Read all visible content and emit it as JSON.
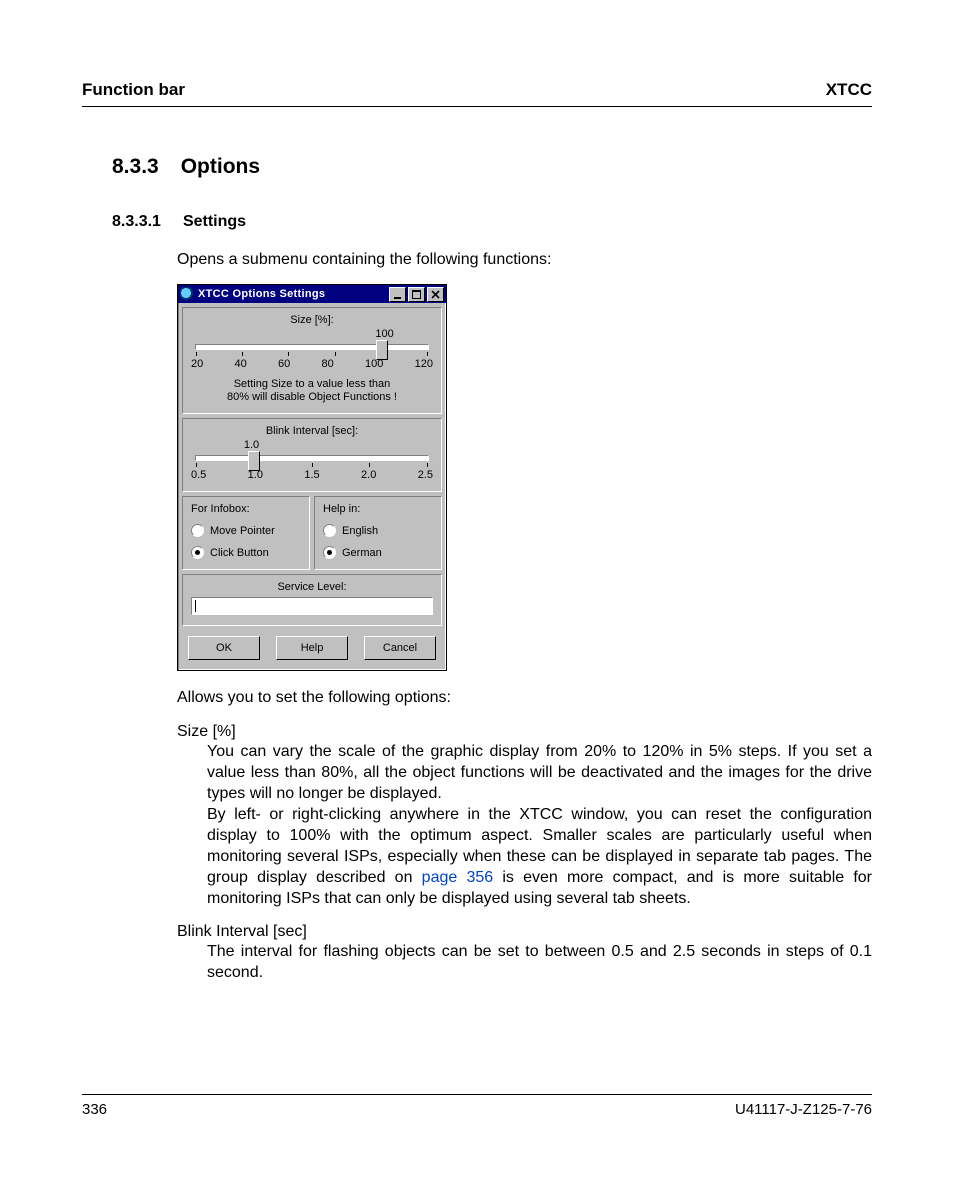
{
  "header": {
    "left": "Function bar",
    "right": "XTCC"
  },
  "section": {
    "num": "8.3.3",
    "title": "Options"
  },
  "subsection": {
    "num": "8.3.3.1",
    "title": "Settings"
  },
  "intro": "Opens a submenu containing the following functions:",
  "after_dialog": "Allows you to set the following options:",
  "opt1": {
    "label": "Size [%]",
    "para1_a": "You can vary the scale of the graphic display from 20% to 120% in 5% steps. If you set a value less than 80%, all the object functions will be deactivated and the images for the drive types will no longer be displayed.",
    "para2_a": "By left- or right-clicking anywhere in the XTCC window, you can reset the configuration display to 100% with the optimum aspect. Smaller scales are particularly useful when monitoring several ISPs, especially when these can be displayed in separate tab pages. The group display described on ",
    "para2_link": "page 356",
    "para2_b": " is even more compact, and is more suitable for monitoring ISPs that can only be displayed using several tab sheets."
  },
  "opt2": {
    "label": "Blink Interval [sec]",
    "para": "The interval for flashing objects can be set to between 0.5 and 2.5 seconds in steps of 0.1 second."
  },
  "footer": {
    "page": "336",
    "doc": "U41117-J-Z125-7-76"
  },
  "dialog": {
    "title": "XTCC Options Settings",
    "size": {
      "label": "Size [%]:",
      "value": "100",
      "ticks": [
        "20",
        "40",
        "60",
        "80",
        "100",
        "120"
      ],
      "note1": "Setting Size to a value less than",
      "note2": "80% will disable Object Functions !"
    },
    "blink": {
      "label": "Blink Interval [sec]:",
      "value": "1.0",
      "ticks": [
        "0.5",
        "1.0",
        "1.5",
        "2.0",
        "2.5"
      ]
    },
    "infobox": {
      "label": "For Infobox:",
      "opt1": "Move Pointer",
      "opt2": "Click Button",
      "selected": 2
    },
    "help": {
      "label": "Help in:",
      "opt1": "English",
      "opt2": "German",
      "selected": 2
    },
    "service_label": "Service Level:",
    "buttons": {
      "ok": "OK",
      "help": "Help",
      "cancel": "Cancel"
    }
  }
}
